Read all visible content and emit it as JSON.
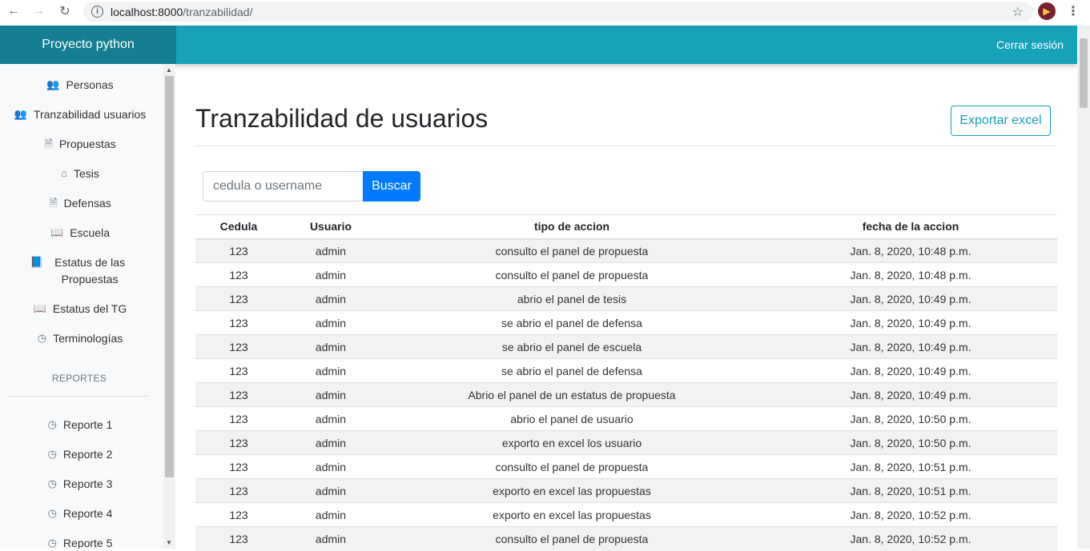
{
  "browser": {
    "url_host": "localhost:8000",
    "url_path": "/tranzabilidad/"
  },
  "navbar": {
    "brand": "Proyecto python",
    "logout": "Cerrar sesión"
  },
  "sidebar": {
    "items": [
      {
        "label": "Personas",
        "icon": "users-icon"
      },
      {
        "label": "Tranzabilidad usuarios",
        "icon": "users-icon"
      },
      {
        "label": "Propuestas",
        "icon": "file-icon"
      },
      {
        "label": "Tesis",
        "icon": "home-icon"
      },
      {
        "label": "Defensas",
        "icon": "file-icon"
      },
      {
        "label": "Escuela",
        "icon": "book-open-icon"
      },
      {
        "label": "Estatus de las Propuestas",
        "icon": "book-icon"
      },
      {
        "label": "Estatus del TG",
        "icon": "book-open-icon"
      },
      {
        "label": "Terminologías",
        "icon": "clock-icon"
      }
    ],
    "reports_heading": "REPORTES",
    "reports": [
      {
        "label": "Reporte 1",
        "icon": "clock-icon"
      },
      {
        "label": "Reporte 2",
        "icon": "clock-icon"
      },
      {
        "label": "Reporte 3",
        "icon": "clock-icon"
      },
      {
        "label": "Reporte 4",
        "icon": "clock-icon"
      },
      {
        "label": "Reporte 5",
        "icon": "clock-icon"
      }
    ]
  },
  "main": {
    "title": "Tranzabilidad de usuarios",
    "export_label": "Exportar excel",
    "search_placeholder": "cedula o username",
    "search_button": "Buscar",
    "table": {
      "headers": [
        "Cedula",
        "Usuario",
        "tipo de accion",
        "fecha de la accion"
      ],
      "rows": [
        [
          "123",
          "admin",
          "consulto el panel de propuesta",
          "Jan. 8, 2020, 10:48 p.m."
        ],
        [
          "123",
          "admin",
          "consulto el panel de propuesta",
          "Jan. 8, 2020, 10:48 p.m."
        ],
        [
          "123",
          "admin",
          "abrio el panel de tesis",
          "Jan. 8, 2020, 10:49 p.m."
        ],
        [
          "123",
          "admin",
          "se abrio el panel de defensa",
          "Jan. 8, 2020, 10:49 p.m."
        ],
        [
          "123",
          "admin",
          "se abrio el panel de escuela",
          "Jan. 8, 2020, 10:49 p.m."
        ],
        [
          "123",
          "admin",
          "se abrio el panel de defensa",
          "Jan. 8, 2020, 10:49 p.m."
        ],
        [
          "123",
          "admin",
          "Abrio el panel de un estatus de propuesta",
          "Jan. 8, 2020, 10:49 p.m."
        ],
        [
          "123",
          "admin",
          "abrio el panel de usuario",
          "Jan. 8, 2020, 10:50 p.m."
        ],
        [
          "123",
          "admin",
          "exporto en excel los usuario",
          "Jan. 8, 2020, 10:50 p.m."
        ],
        [
          "123",
          "admin",
          "consulto el panel de propuesta",
          "Jan. 8, 2020, 10:51 p.m."
        ],
        [
          "123",
          "admin",
          "exporto en excel las propuestas",
          "Jan. 8, 2020, 10:51 p.m."
        ],
        [
          "123",
          "admin",
          "exporto en excel las propuestas",
          "Jan. 8, 2020, 10:52 p.m."
        ],
        [
          "123",
          "admin",
          "consulto el panel de propuesta",
          "Jan. 8, 2020, 10:52 p.m."
        ]
      ]
    }
  },
  "colors": {
    "navbar": "#17a2b8",
    "brand": "#137f90",
    "primary": "#007bff"
  }
}
